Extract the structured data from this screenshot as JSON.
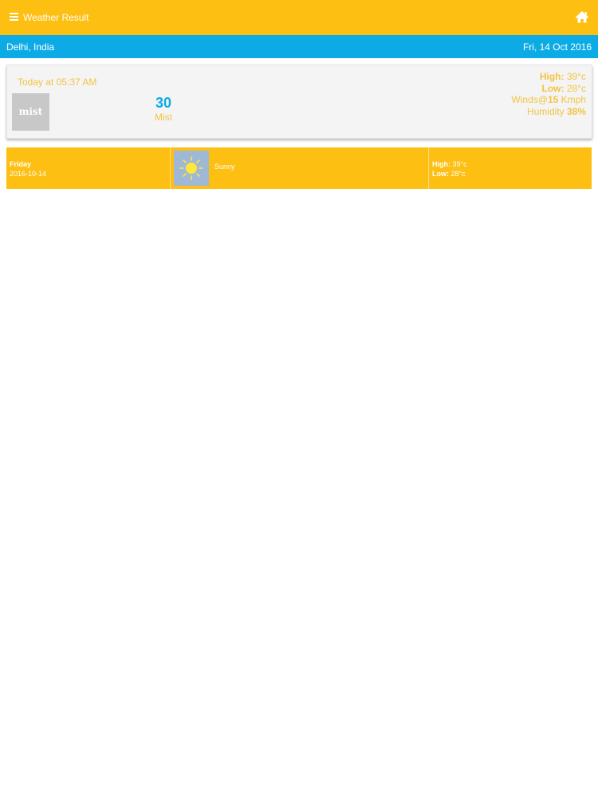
{
  "header": {
    "title": "Weather Result",
    "menu_icon": "menu-icon",
    "home_icon": "home-icon"
  },
  "location_bar": {
    "location": "Delhi, India",
    "date": "Fri, 14 Oct 2016"
  },
  "today": {
    "label": "Today at 05:37 AM",
    "icon_text": "mist",
    "temperature": "30",
    "condition": "Mist",
    "high_label": "High:",
    "high_value": "39°c",
    "low_label": "Low:",
    "low_value": "28°c",
    "winds_label": "Winds@",
    "winds_value": "15",
    "winds_unit": "Kmph",
    "humidity_label": "Humidity",
    "humidity_value": "38%"
  },
  "forecast": [
    {
      "day": "Friday",
      "date": "2016-10-14",
      "icon": "sun-icon",
      "condition": "Sunny",
      "high_label": "High:",
      "high_value": "39°c",
      "low_label": "Low:",
      "low_value": "28°c"
    }
  ],
  "colors": {
    "primary": "#FDBF12",
    "accent": "#0CABE5",
    "text_accent": "#F2C444"
  }
}
